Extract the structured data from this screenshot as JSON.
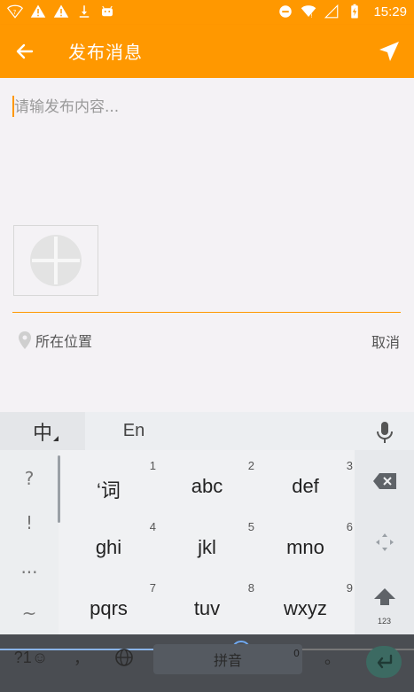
{
  "status_bar": {
    "time": "15:29",
    "left_icons": [
      "wifi-question-icon",
      "warning-icon",
      "warning-icon",
      "download-icon",
      "android-icon"
    ],
    "right_icons": [
      "do-not-disturb-icon",
      "wifi-icon",
      "signal-icon",
      "battery-charging-icon"
    ]
  },
  "app_bar": {
    "title": "发布消息",
    "back_icon": "arrow-back-icon",
    "send_icon": "send-icon",
    "color": "#ff9800"
  },
  "post": {
    "placeholder": "请输发布内容...",
    "value": ""
  },
  "location": {
    "label": "所在位置",
    "cancel": "取消"
  },
  "keyboard": {
    "mode_zh": "中",
    "mode_en": "En",
    "symbols": [
      "?",
      "!",
      "...",
      "~"
    ],
    "keys": [
      {
        "num": "1",
        "label": "‘词"
      },
      {
        "num": "2",
        "label": "abc"
      },
      {
        "num": "3",
        "label": "def"
      },
      {
        "num": "4",
        "label": "ghi"
      },
      {
        "num": "5",
        "label": "jkl"
      },
      {
        "num": "6",
        "label": "mno"
      },
      {
        "num": "7",
        "label": "pqrs"
      },
      {
        "num": "8",
        "label": "tuv"
      },
      {
        "num": "9",
        "label": "wxyz"
      }
    ],
    "num_switch": "123",
    "bottom": {
      "symbol_key": "?1☺",
      "comma": "，",
      "space": "拼音",
      "zero": "0",
      "period": "。"
    }
  }
}
